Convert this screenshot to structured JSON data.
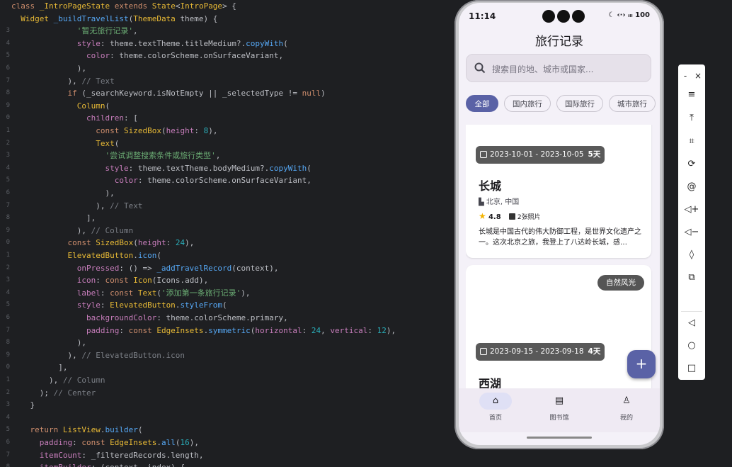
{
  "editor": {
    "lines": [
      [
        [
          "kw",
          "class "
        ],
        [
          "cls",
          "_IntroPageState "
        ],
        [
          "kw",
          "extends "
        ],
        [
          "cls",
          "State"
        ],
        [
          "df",
          "<"
        ],
        [
          "cls",
          "IntroPage"
        ],
        [
          "df",
          "> {"
        ]
      ],
      [
        [
          "df",
          "  "
        ],
        [
          "cls",
          "Widget "
        ],
        [
          "fn",
          "_buildTravelList"
        ],
        [
          "df",
          "("
        ],
        [
          "cls",
          "ThemeData "
        ],
        [
          "df",
          "theme) {"
        ]
      ],
      [
        [
          "df",
          "              "
        ],
        [
          "str",
          "'暂无旅行记录'"
        ],
        [
          "df",
          ","
        ]
      ],
      [
        [
          "df",
          "              "
        ],
        [
          "pr",
          "style"
        ],
        [
          "df",
          ": theme.textTheme.titleMedium?."
        ],
        [
          "fn",
          "copyWith"
        ],
        [
          "df",
          "("
        ]
      ],
      [
        [
          "df",
          "                "
        ],
        [
          "pr",
          "color"
        ],
        [
          "df",
          ": theme.colorScheme.onSurfaceVariant,"
        ]
      ],
      [
        [
          "df",
          "              ),"
        ]
      ],
      [
        [
          "df",
          "            ), "
        ],
        [
          "cm",
          "// Text"
        ]
      ],
      [
        [
          "df",
          "            "
        ],
        [
          "kw",
          "if "
        ],
        [
          "df",
          "(_searchKeyword.isNotEmpty || _selectedType != "
        ],
        [
          "kw",
          "null"
        ],
        [
          "df",
          ")"
        ]
      ],
      [
        [
          "df",
          "              "
        ],
        [
          "cls",
          "Column"
        ],
        [
          "df",
          "("
        ]
      ],
      [
        [
          "df",
          "                "
        ],
        [
          "pr",
          "children"
        ],
        [
          "df",
          ": ["
        ]
      ],
      [
        [
          "df",
          "                  "
        ],
        [
          "kw",
          "const "
        ],
        [
          "cls",
          "SizedBox"
        ],
        [
          "df",
          "("
        ],
        [
          "pr",
          "height"
        ],
        [
          "df",
          ": "
        ],
        [
          "num",
          "8"
        ],
        [
          "df",
          "),"
        ]
      ],
      [
        [
          "df",
          "                  "
        ],
        [
          "cls",
          "Text"
        ],
        [
          "df",
          "("
        ]
      ],
      [
        [
          "df",
          "                    "
        ],
        [
          "str",
          "'尝试调整搜索条件或旅行类型'"
        ],
        [
          "df",
          ","
        ]
      ],
      [
        [
          "df",
          "                    "
        ],
        [
          "pr",
          "style"
        ],
        [
          "df",
          ": theme.textTheme.bodyMedium?."
        ],
        [
          "fn",
          "copyWith"
        ],
        [
          "df",
          "("
        ]
      ],
      [
        [
          "df",
          "                      "
        ],
        [
          "pr",
          "color"
        ],
        [
          "df",
          ": theme.colorScheme.onSurfaceVariant,"
        ]
      ],
      [
        [
          "df",
          "                    ),"
        ]
      ],
      [
        [
          "df",
          "                  ), "
        ],
        [
          "cm",
          "// Text"
        ]
      ],
      [
        [
          "df",
          "                ],"
        ]
      ],
      [
        [
          "df",
          "              ), "
        ],
        [
          "cm",
          "// Column"
        ]
      ],
      [
        [
          "df",
          "            "
        ],
        [
          "kw",
          "const "
        ],
        [
          "cls",
          "SizedBox"
        ],
        [
          "df",
          "("
        ],
        [
          "pr",
          "height"
        ],
        [
          "df",
          ": "
        ],
        [
          "num",
          "24"
        ],
        [
          "df",
          "),"
        ]
      ],
      [
        [
          "df",
          "            "
        ],
        [
          "cls",
          "ElevatedButton"
        ],
        [
          "df",
          "."
        ],
        [
          "fn",
          "icon"
        ],
        [
          "df",
          "("
        ]
      ],
      [
        [
          "df",
          "              "
        ],
        [
          "pr",
          "onPressed"
        ],
        [
          "df",
          ": () => "
        ],
        [
          "fn",
          "_addTravelRecord"
        ],
        [
          "df",
          "(context),"
        ]
      ],
      [
        [
          "df",
          "              "
        ],
        [
          "pr",
          "icon"
        ],
        [
          "df",
          ": "
        ],
        [
          "kw",
          "const "
        ],
        [
          "cls",
          "Icon"
        ],
        [
          "df",
          "(Icons.add),"
        ]
      ],
      [
        [
          "df",
          "              "
        ],
        [
          "pr",
          "label"
        ],
        [
          "df",
          ": "
        ],
        [
          "kw",
          "const "
        ],
        [
          "cls",
          "Text"
        ],
        [
          "df",
          "("
        ],
        [
          "str",
          "'添加第一条旅行记录'"
        ],
        [
          "df",
          "),"
        ]
      ],
      [
        [
          "df",
          "              "
        ],
        [
          "pr",
          "style"
        ],
        [
          "df",
          ": "
        ],
        [
          "cls",
          "ElevatedButton"
        ],
        [
          "df",
          "."
        ],
        [
          "fn",
          "styleFrom"
        ],
        [
          "df",
          "("
        ]
      ],
      [
        [
          "df",
          "                "
        ],
        [
          "pr",
          "backgroundColor"
        ],
        [
          "df",
          ": theme.colorScheme.primary,"
        ]
      ],
      [
        [
          "df",
          "                "
        ],
        [
          "pr",
          "padding"
        ],
        [
          "df",
          ": "
        ],
        [
          "kw",
          "const "
        ],
        [
          "cls",
          "EdgeInsets"
        ],
        [
          "df",
          "."
        ],
        [
          "fn",
          "symmetric"
        ],
        [
          "df",
          "("
        ],
        [
          "pr",
          "horizontal"
        ],
        [
          "df",
          ": "
        ],
        [
          "num",
          "24"
        ],
        [
          "df",
          ", "
        ],
        [
          "pr",
          "vertical"
        ],
        [
          "df",
          ": "
        ],
        [
          "num",
          "12"
        ],
        [
          "df",
          "),"
        ]
      ],
      [
        [
          "df",
          "              ),"
        ]
      ],
      [
        [
          "df",
          "            ), "
        ],
        [
          "cm",
          "// ElevatedButton.icon"
        ]
      ],
      [
        [
          "df",
          "          ],"
        ]
      ],
      [
        [
          "df",
          "        ), "
        ],
        [
          "cm",
          "// Column"
        ]
      ],
      [
        [
          "df",
          "      ); "
        ],
        [
          "cm",
          "// Center"
        ]
      ],
      [
        [
          "df",
          "    }"
        ]
      ],
      [
        [
          "df",
          " "
        ]
      ],
      [
        [
          "df",
          "    "
        ],
        [
          "kw",
          "return "
        ],
        [
          "cls",
          "ListView"
        ],
        [
          "df",
          "."
        ],
        [
          "fn",
          "builder"
        ],
        [
          "df",
          "("
        ]
      ],
      [
        [
          "df",
          "      "
        ],
        [
          "pr",
          "padding"
        ],
        [
          "df",
          ": "
        ],
        [
          "kw",
          "const "
        ],
        [
          "cls",
          "EdgeInsets"
        ],
        [
          "df",
          "."
        ],
        [
          "fn",
          "all"
        ],
        [
          "df",
          "("
        ],
        [
          "num",
          "16"
        ],
        [
          "df",
          "),"
        ]
      ],
      [
        [
          "df",
          "      "
        ],
        [
          "pr",
          "itemCount"
        ],
        [
          "df",
          ": _filteredRecords.length,"
        ]
      ],
      [
        [
          "df",
          "      "
        ],
        [
          "pr",
          "itemBuilder"
        ],
        [
          "df",
          ": (context, index) {"
        ]
      ]
    ],
    "line_numbers": [
      "",
      "",
      "3",
      "4",
      "5",
      "6",
      "7",
      "8",
      "9",
      "0",
      "1",
      "2",
      "3",
      "4",
      "5",
      "6",
      "7",
      "8",
      "9",
      "0",
      "1",
      "2",
      "3",
      "4",
      "5",
      "6",
      "7",
      "8",
      "9",
      "0",
      "1",
      "2",
      "3",
      "4",
      "5",
      "6",
      "7",
      "8"
    ]
  },
  "phone": {
    "status": {
      "time": "11:14",
      "icons": "☾ ‹·› ᵢₗₗ 100"
    },
    "title": "旅行记录",
    "search_placeholder": "搜索目的地、城市或国家...",
    "chips": [
      "全部",
      "国内旅行",
      "国际旅行",
      "城市旅行",
      ""
    ],
    "selected_chip": "全部",
    "cards": [
      {
        "date": "2023-10-01 - 2023-10-05",
        "days": "5天",
        "title": "长城",
        "location": "北京, 中国",
        "rating": "4.8",
        "photos": "2张照片",
        "description": "长城是中国古代的伟大防御工程，是世界文化遗产之一。这次北京之旅，我登上了八达岭长城，感…"
      },
      {
        "type": "自然风光",
        "date": "2023-09-15 - 2023-09-18",
        "days": "4天",
        "title": "西湖"
      }
    ],
    "fab": "+",
    "nav": [
      {
        "label": "首页",
        "icon": "home-icon",
        "glyph": "⌂"
      },
      {
        "label": "图书馆",
        "icon": "library-icon",
        "glyph": "▤"
      },
      {
        "label": "我的",
        "icon": "person-icon",
        "glyph": "♙"
      }
    ]
  },
  "emulator_toolbar": {
    "minimize": "-",
    "close": "×",
    "buttons": [
      {
        "name": "menu-icon",
        "glyph": "≡"
      },
      {
        "name": "pin-top-icon",
        "glyph": "⤒"
      },
      {
        "name": "crop-icon",
        "glyph": "⌗"
      },
      {
        "name": "rotate-icon",
        "glyph": "⟳"
      },
      {
        "name": "at-icon",
        "glyph": "@"
      },
      {
        "name": "volume-up-icon",
        "glyph": "◁+"
      },
      {
        "name": "volume-down-icon",
        "glyph": "◁−"
      },
      {
        "name": "rotate-device-icon",
        "glyph": "◊"
      },
      {
        "name": "screenshot-icon",
        "glyph": "⧉"
      },
      {
        "name": "back-icon",
        "glyph": "◁"
      },
      {
        "name": "home-circle-icon",
        "glyph": "○"
      },
      {
        "name": "overview-icon",
        "glyph": "□"
      }
    ]
  }
}
